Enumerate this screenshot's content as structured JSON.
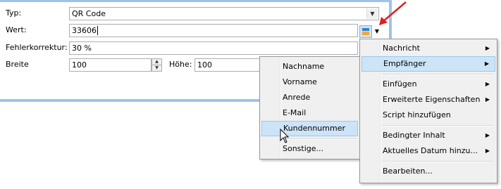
{
  "form": {
    "type_label": "Typ:",
    "type_value": "QR Code",
    "value_label": "Wert:",
    "value_value": "33606",
    "errcorr_label": "Fehlerkorrektur:",
    "errcorr_value": "30 %",
    "width_label": "Breite",
    "width_value": "100",
    "height_label": "Höhe:",
    "height_value": "100"
  },
  "submenu": {
    "items": [
      "Nachname",
      "Vorname",
      "Anrede",
      "E-Mail",
      "Kundennummer"
    ],
    "other": "Sonstige...",
    "highlighted": "Kundennummer"
  },
  "mainmenu": {
    "nachricht": "Nachricht",
    "empfaenger": "Empfänger",
    "einfuegen": "Einfügen",
    "erweiterte": "Erweiterte Eigenschaften",
    "script": "Script hinzufügen",
    "bedingter": "Bedingter Inhalt",
    "datum": "Aktuelles Datum hinzu...",
    "bearbeiten": "Bearbeiten...",
    "highlighted": "Empfänger"
  },
  "colors": {
    "accent_border": "#9fc3e8",
    "highlight": "#cde4f7",
    "arrow": "#e02020"
  }
}
